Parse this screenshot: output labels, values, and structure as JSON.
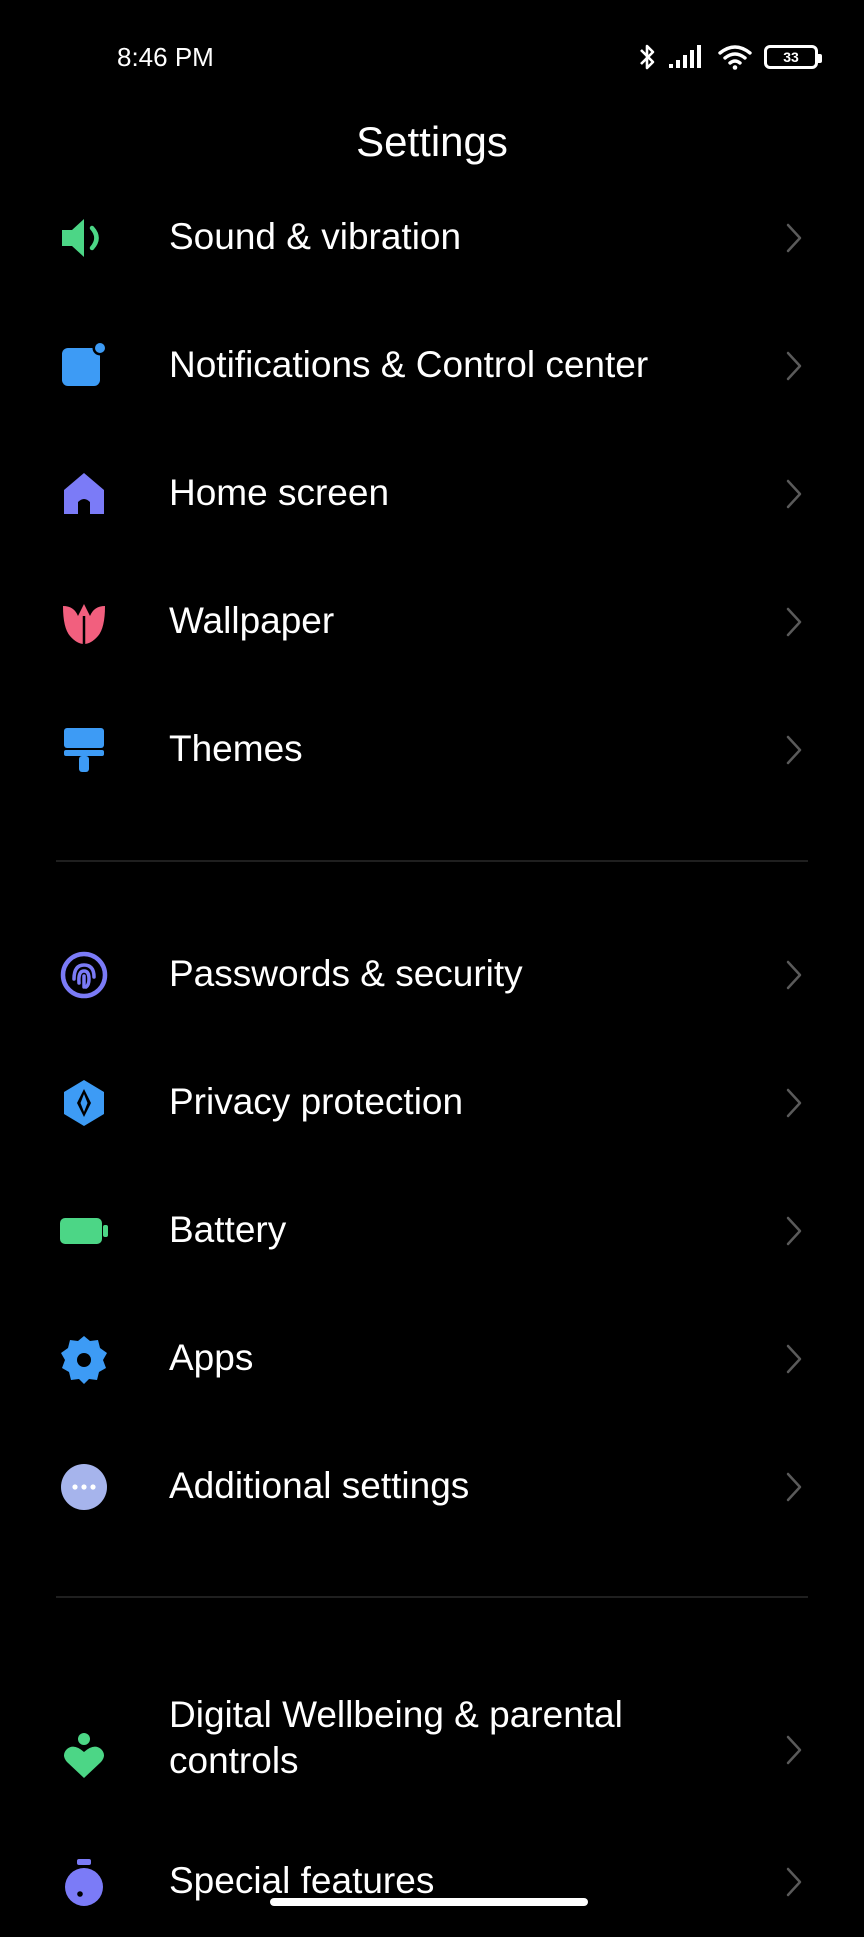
{
  "status_bar": {
    "time": "8:46 PM",
    "battery_level": "33",
    "icons": [
      "bluetooth-icon",
      "signal-icon",
      "wifi-icon",
      "battery-icon"
    ]
  },
  "header": {
    "title": "Settings"
  },
  "groups": [
    {
      "items": [
        {
          "label": "Sound & vibration",
          "icon": "speaker-icon",
          "color": "#4cd686"
        },
        {
          "label": "Notifications & Control center",
          "icon": "notification-icon",
          "color": "#3d9bf5"
        },
        {
          "label": "Home screen",
          "icon": "home-icon",
          "color": "#7b7bf7"
        },
        {
          "label": "Wallpaper",
          "icon": "tulip-icon",
          "color": "#f25f7e"
        },
        {
          "label": "Themes",
          "icon": "paintbrush-icon",
          "color": "#3d9bf5"
        }
      ]
    },
    {
      "items": [
        {
          "label": "Passwords & security",
          "icon": "fingerprint-icon",
          "color": "#7b7bf7"
        },
        {
          "label": "Privacy protection",
          "icon": "privacy-icon",
          "color": "#3d9bf5"
        },
        {
          "label": "Battery",
          "icon": "battery-icon",
          "color": "#4cd686"
        },
        {
          "label": "Apps",
          "icon": "gear-icon",
          "color": "#3d9bf5"
        },
        {
          "label": "Additional settings",
          "icon": "more-icon",
          "color": "#a6b4ec"
        }
      ]
    },
    {
      "items": [
        {
          "label": "Digital Wellbeing & parental controls",
          "icon": "wellbeing-icon",
          "color": "#4cd686"
        },
        {
          "label": "Special features",
          "icon": "special-features-icon",
          "color": "#7b7bf7"
        }
      ]
    }
  ],
  "colors": {
    "background": "#000000",
    "text": "#ffffff",
    "chevron": "#5a5a5a",
    "divider": "#1f1f1f"
  }
}
